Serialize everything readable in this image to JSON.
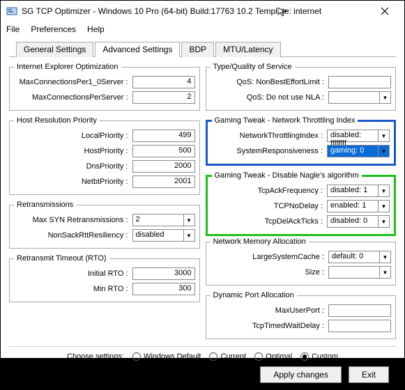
{
  "window": {
    "title": "SG TCP Optimizer - Windows 10 Pro (64-bit) Build:17763 10.2  Template: internet"
  },
  "menu": {
    "file": "File",
    "prefs": "Preferences",
    "help": "Help"
  },
  "tabs": {
    "general": "General Settings",
    "advanced": "Advanced Settings",
    "bdp": "BDP",
    "mtu": "MTU/Latency"
  },
  "left": {
    "ie": {
      "legend": "Internet Explorer Optimization",
      "row1": {
        "label": "MaxConnectionsPer1_0Server :",
        "value": "4"
      },
      "row2": {
        "label": "MaxConnectionsPerServer :",
        "value": "2"
      }
    },
    "hrp": {
      "legend": "Host Resolution Priority",
      "local": {
        "label": "LocalPriority :",
        "value": "499"
      },
      "host": {
        "label": "HostPriority :",
        "value": "500"
      },
      "dns": {
        "label": "DnsPriority :",
        "value": "2000"
      },
      "netbt": {
        "label": "NetbtPriority :",
        "value": "2001"
      }
    },
    "retr": {
      "legend": "Retransmissions",
      "syn": {
        "label": "Max SYN Retransmissions :",
        "value": "2"
      },
      "nonsack": {
        "label": "NonSackRttResiliency :",
        "value": "disabled"
      }
    },
    "rto": {
      "legend": "Retransmit Timeout (RTO)",
      "initial": {
        "label": "Initial RTO :",
        "value": "3000"
      },
      "min": {
        "label": "Min RTO :",
        "value": "300"
      }
    }
  },
  "right": {
    "qos": {
      "legend": "Type/Quality of Service",
      "nbel": {
        "label": "QoS: NonBestEffortLimit :",
        "value": ""
      },
      "nla": {
        "label": "QoS: Do not use NLA :",
        "value": ""
      }
    },
    "throttle": {
      "legend": "Gaming Tweak - Network Throttling Index",
      "nti": {
        "label": "NetworkThrottlingIndex :",
        "value": "disabled: ffffffff"
      },
      "sr": {
        "label": "SystemResponsiveness :",
        "value": "gaming: 0"
      }
    },
    "nagle": {
      "legend": "Gaming Tweak - Disable Nagle's algorithm",
      "ack": {
        "label": "TcpAckFrequency :",
        "value": "disabled: 1"
      },
      "nodelay": {
        "label": "TCPNoDelay :",
        "value": "enabled: 1"
      },
      "delack": {
        "label": "TcpDelAckTicks :",
        "value": "disabled: 0"
      }
    },
    "mem": {
      "legend": "Network Memory Allocation",
      "lsc": {
        "label": "LargeSystemCache :",
        "value": "default: 0"
      },
      "size": {
        "label": "Size :",
        "value": ""
      }
    },
    "dyn": {
      "legend": "Dynamic Port Allocation",
      "maxup": {
        "label": "MaxUserPort :",
        "value": ""
      },
      "twd": {
        "label": "TcpTimedWaitDelay :",
        "value": ""
      }
    }
  },
  "footer": {
    "choose": "Choose settings:",
    "opts": {
      "wd": "Windows Default",
      "cur": "Current",
      "opt": "Optimal",
      "cus": "Custom"
    },
    "apply": "Apply changes",
    "exit": "Exit"
  }
}
